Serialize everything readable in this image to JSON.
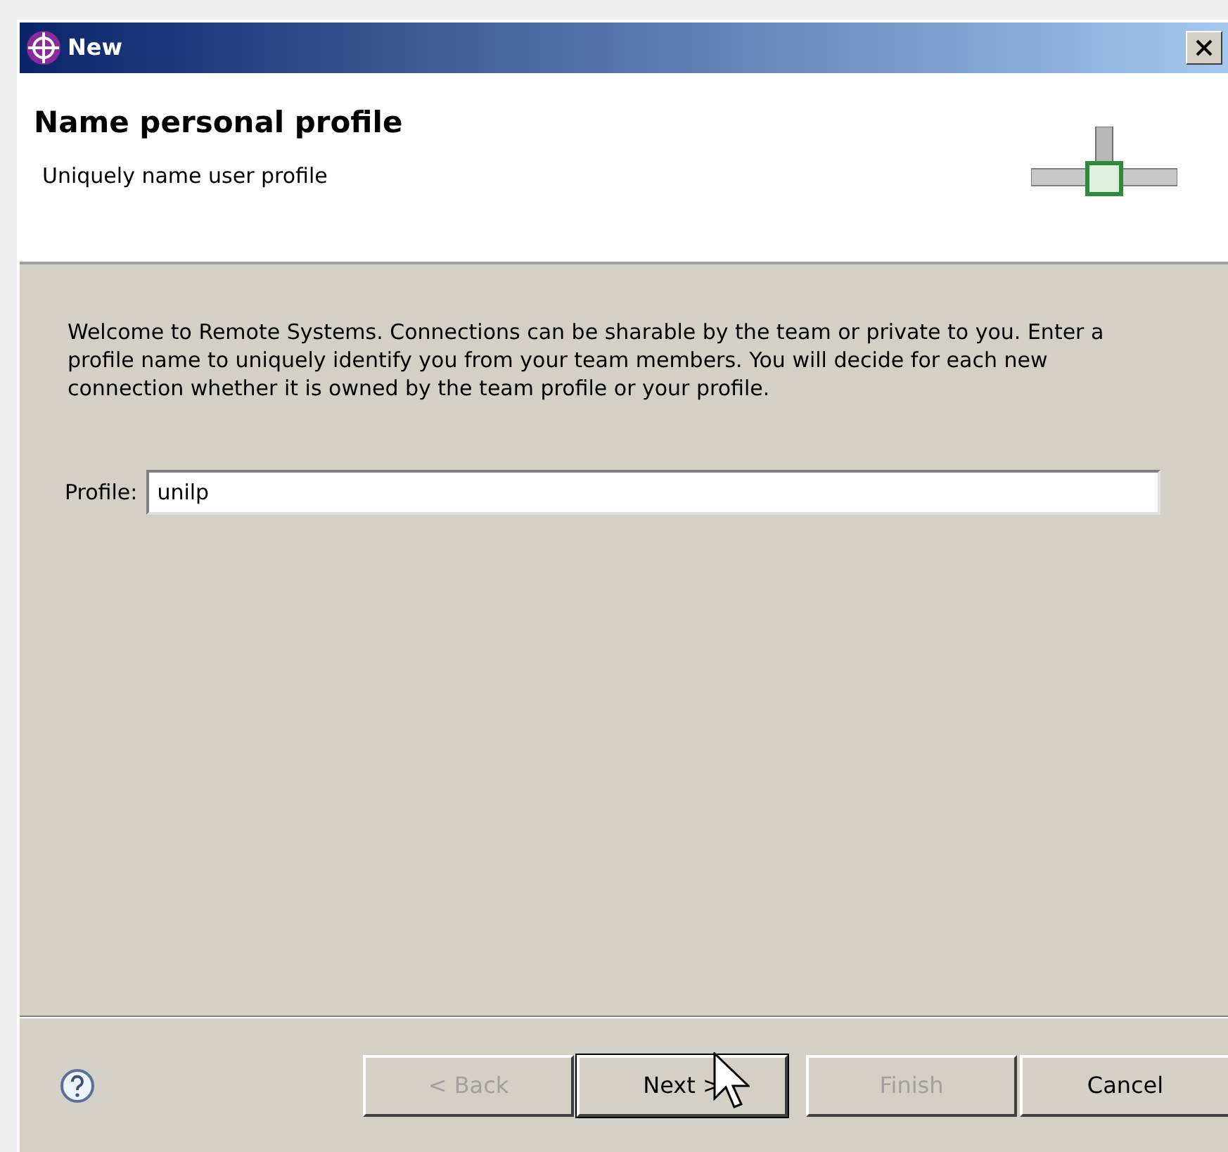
{
  "window": {
    "title": "New"
  },
  "header": {
    "title": "Name personal profile",
    "subtitle": "Uniquely name user profile"
  },
  "description": "Welcome to Remote Systems. Connections can be sharable by the team or private to you. Enter a profile name to uniquely identify you from your team members. You will decide for each new connection whether it is owned by the team profile or your profile.",
  "profile_field": {
    "label": "Profile:",
    "value": "unilp"
  },
  "buttons": [
    {
      "label": "< Back",
      "disabled": true,
      "default": false
    },
    {
      "label": "Next >",
      "disabled": false,
      "default": true
    },
    {
      "label": "Finish",
      "disabled": true,
      "default": false
    },
    {
      "label": "Cancel",
      "disabled": false,
      "default": false
    }
  ]
}
